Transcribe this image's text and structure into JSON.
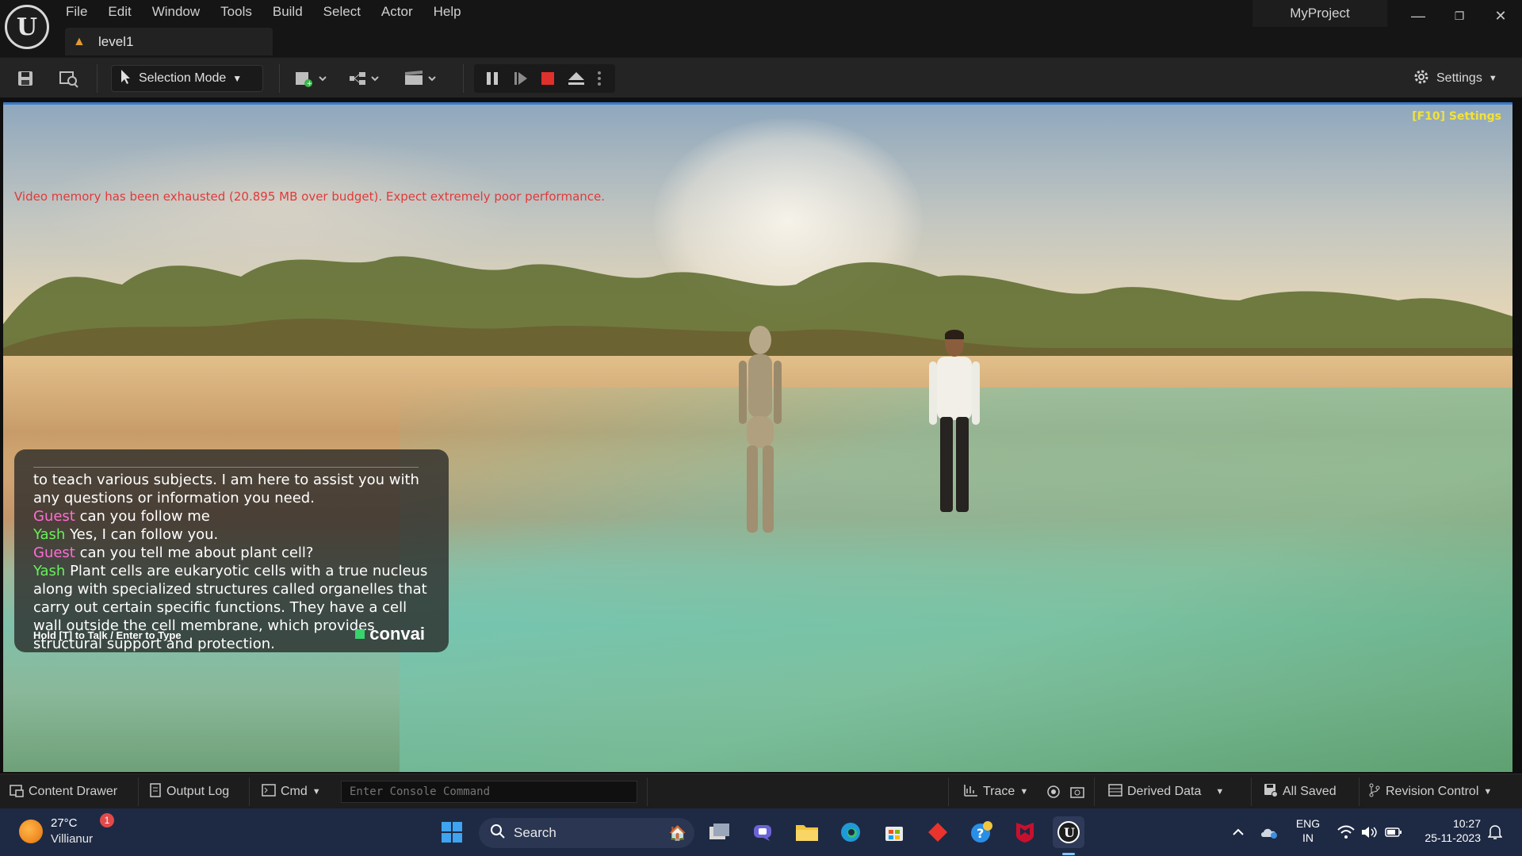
{
  "app": {
    "project_name": "MyProject",
    "level_tab": "level1",
    "menu": [
      "File",
      "Edit",
      "Window",
      "Tools",
      "Build",
      "Select",
      "Actor",
      "Help"
    ],
    "window_controls": [
      "minimize-icon",
      "restore-icon",
      "close-icon"
    ]
  },
  "toolbar": {
    "selection_mode": "Selection Mode",
    "settings": "Settings",
    "icons": [
      "save-icon",
      "browse-icon",
      "add-actor-icon",
      "blueprint-icon",
      "cinematics-icon",
      "pause-icon",
      "step-frame-icon",
      "stop-icon",
      "eject-icon",
      "more-options-icon",
      "gear-icon"
    ],
    "stop_color": "#e0302c"
  },
  "viewport": {
    "warning": "Video memory has been exhausted (20.895 MB over budget). Expect extremely poor performance.",
    "warning_color": "#e03a3a",
    "f10_settings": "[F10] Settings",
    "f10_color": "#f2e23a",
    "chat": {
      "lines": [
        {
          "speaker": "",
          "text": "to teach various subjects.  I am here to assist you with any questions or information you need."
        },
        {
          "speaker": "Guest",
          "text": "can you follow me"
        },
        {
          "speaker": "Yash",
          "text": "Yes, I can follow you."
        },
        {
          "speaker": "Guest",
          "text": "can you tell me about plant cell?"
        },
        {
          "speaker": "Yash",
          "text": "Plant cells are eukaryotic cells with a true nucleus along with specialized structures called organelles that carry out certain specific functions. They have a cell wall outside the cell membrane, which provides structural support and protection."
        }
      ],
      "guest_color": "#ff6cd6",
      "yash_color": "#67f05a",
      "hint": "Hold [T] to Talk / Enter to Type",
      "brand": "convai"
    }
  },
  "bottombar": {
    "content_drawer": "Content Drawer",
    "output_log": "Output Log",
    "cmd": "Cmd",
    "console_placeholder": "Enter Console Command",
    "trace": "Trace",
    "derived_data": "Derived Data",
    "all_saved": "All Saved",
    "revision_control": "Revision Control"
  },
  "taskbar": {
    "weather_temp": "27°C",
    "weather_location": "Villianur",
    "weather_badge": "1",
    "search": "Search",
    "apps": [
      "start-icon",
      "search-icon",
      "task-view-icon",
      "teams-icon",
      "file-explorer-icon",
      "edge-icon",
      "store-icon",
      "app-diamond-icon",
      "help-icon",
      "mcafee-icon",
      "unreal-engine-icon"
    ],
    "tray": {
      "lang_line1": "ENG",
      "lang_line2": "IN",
      "time": "10:27",
      "date": "25-11-2023"
    }
  }
}
